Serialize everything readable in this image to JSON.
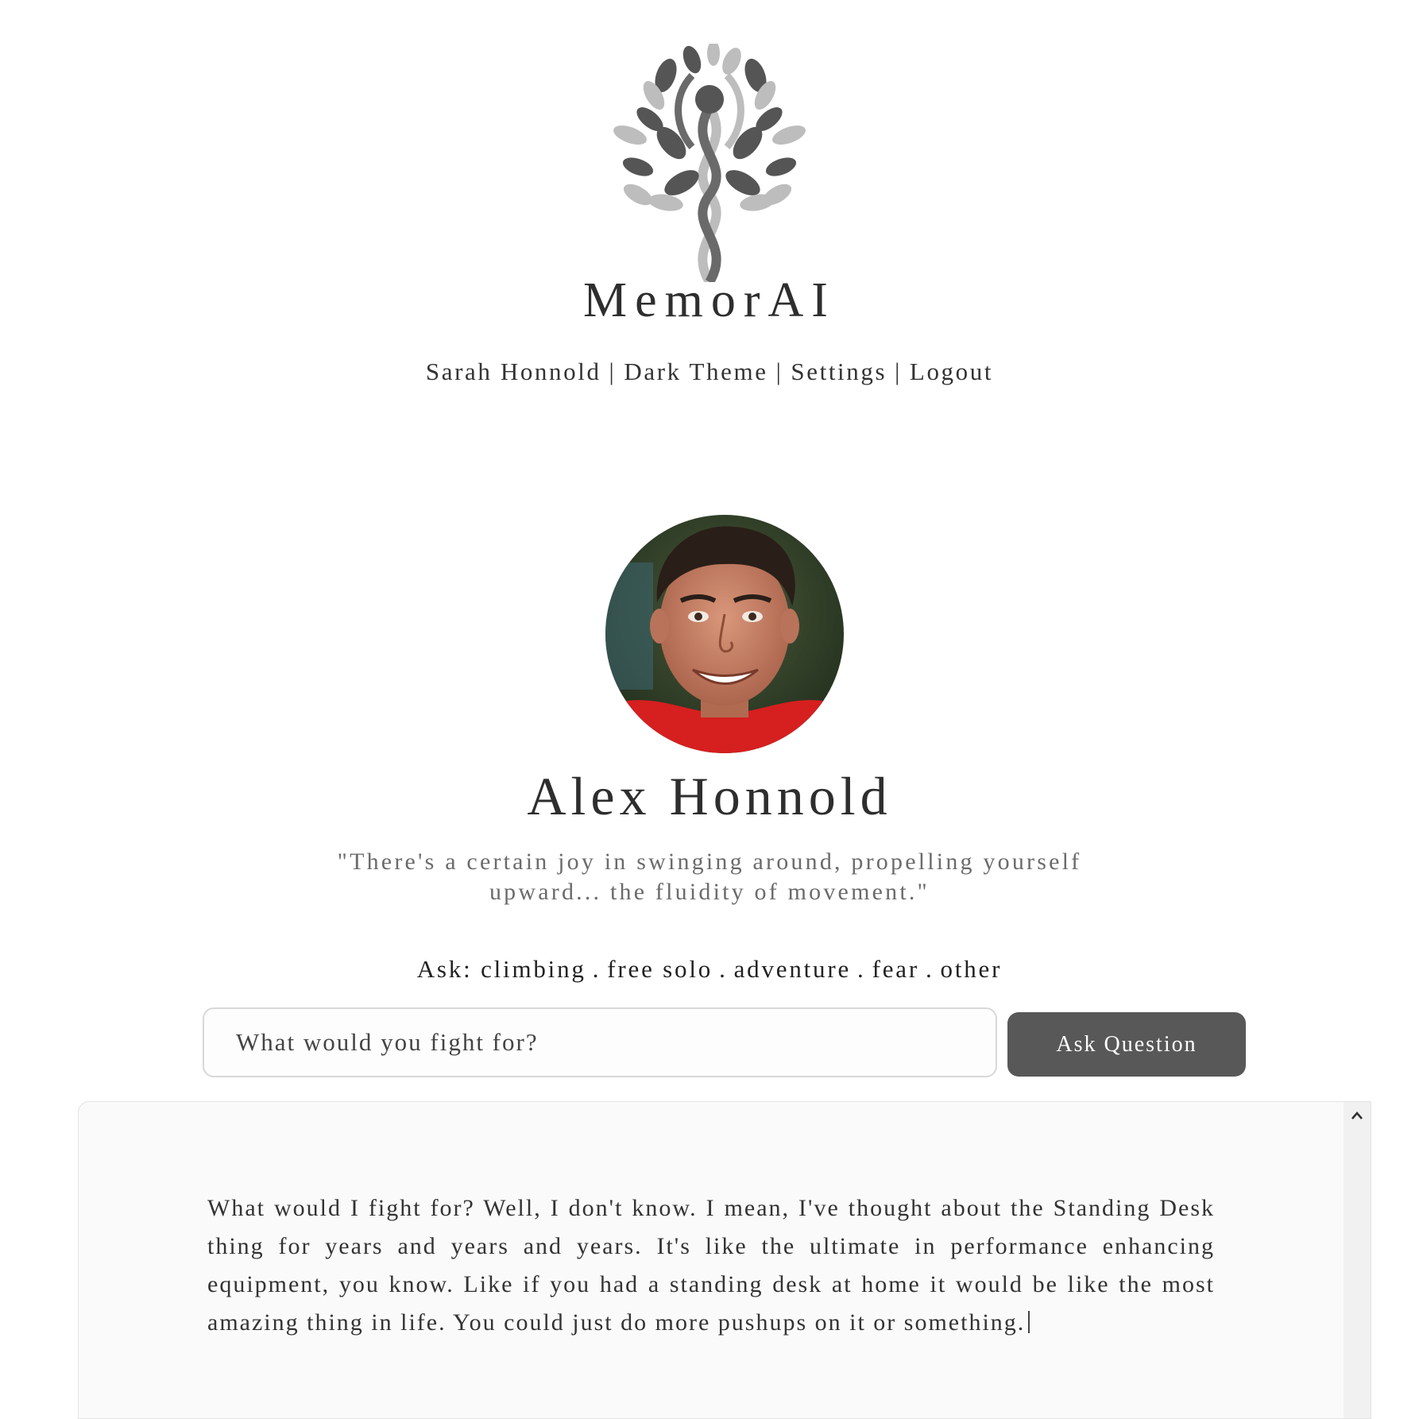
{
  "brand": {
    "name": "MemorAI",
    "logo_icon": "tree-of-life-logo-icon"
  },
  "nav": {
    "user": "Sarah Honnold",
    "theme": "Dark Theme",
    "settings": "Settings",
    "logout": "Logout",
    "separator": "|"
  },
  "profile": {
    "name": "Alex Honnold",
    "quote": "\"There's a certain joy in swinging around, propelling yourself upward... the fluidity of movement.\"",
    "avatar_icon": "avatar-photo"
  },
  "ask": {
    "label": "Ask:",
    "topics": [
      "climbing",
      "free solo",
      "adventure",
      "fear",
      "other"
    ],
    "separator": "."
  },
  "question": {
    "value": "What would you fight for?",
    "placeholder": "What would you fight for?",
    "button_label": "Ask Question"
  },
  "answer": {
    "text": "What would I fight for? Well, I don't know. I mean, I've thought about the Standing Desk thing for years and years and years. It's like the ultimate in performance enhancing equipment, you know. Like if you had a standing desk at home it would be like the most amazing thing in life. You could just do more pushups on it or something."
  },
  "colors": {
    "button_bg": "#585858",
    "text": "#333333",
    "quote": "#6b6b6b",
    "panel_bg": "#fafafa"
  }
}
